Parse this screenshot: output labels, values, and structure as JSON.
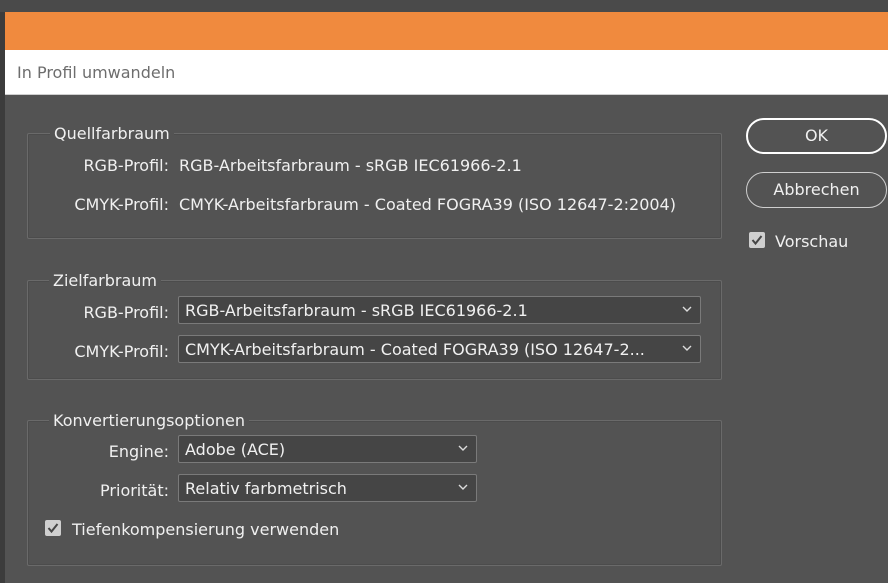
{
  "window": {
    "title": "In Profil umwandeln"
  },
  "source": {
    "legend": "Quellfarbraum",
    "rgb_label": "RGB-Profil:",
    "rgb_value": "RGB-Arbeitsfarbraum - sRGB IEC61966-2.1",
    "cmyk_label": "CMYK-Profil:",
    "cmyk_value": "CMYK-Arbeitsfarbraum - Coated FOGRA39 (ISO 12647-2:2004)"
  },
  "destination": {
    "legend": "Zielfarbraum",
    "rgb_label": "RGB-Profil:",
    "rgb_value": "RGB-Arbeitsfarbraum - sRGB IEC61966-2.1",
    "cmyk_label": "CMYK-Profil:",
    "cmyk_value": "CMYK-Arbeitsfarbraum - Coated FOGRA39 (ISO 12647-2..."
  },
  "conversion": {
    "legend": "Konvertierungsoptionen",
    "engine_label": "Engine:",
    "engine_value": "Adobe (ACE)",
    "priority_label": "Priorität:",
    "priority_value": "Relativ farbmetrisch",
    "blackpoint_label": "Tiefenkompensierung verwenden",
    "blackpoint_checked": true
  },
  "buttons": {
    "ok": "OK",
    "cancel": "Abbrechen"
  },
  "preview": {
    "label": "Vorschau",
    "checked": true
  },
  "colors": {
    "accent_bar": "#f08a3e",
    "dialog_bg": "#535353"
  }
}
